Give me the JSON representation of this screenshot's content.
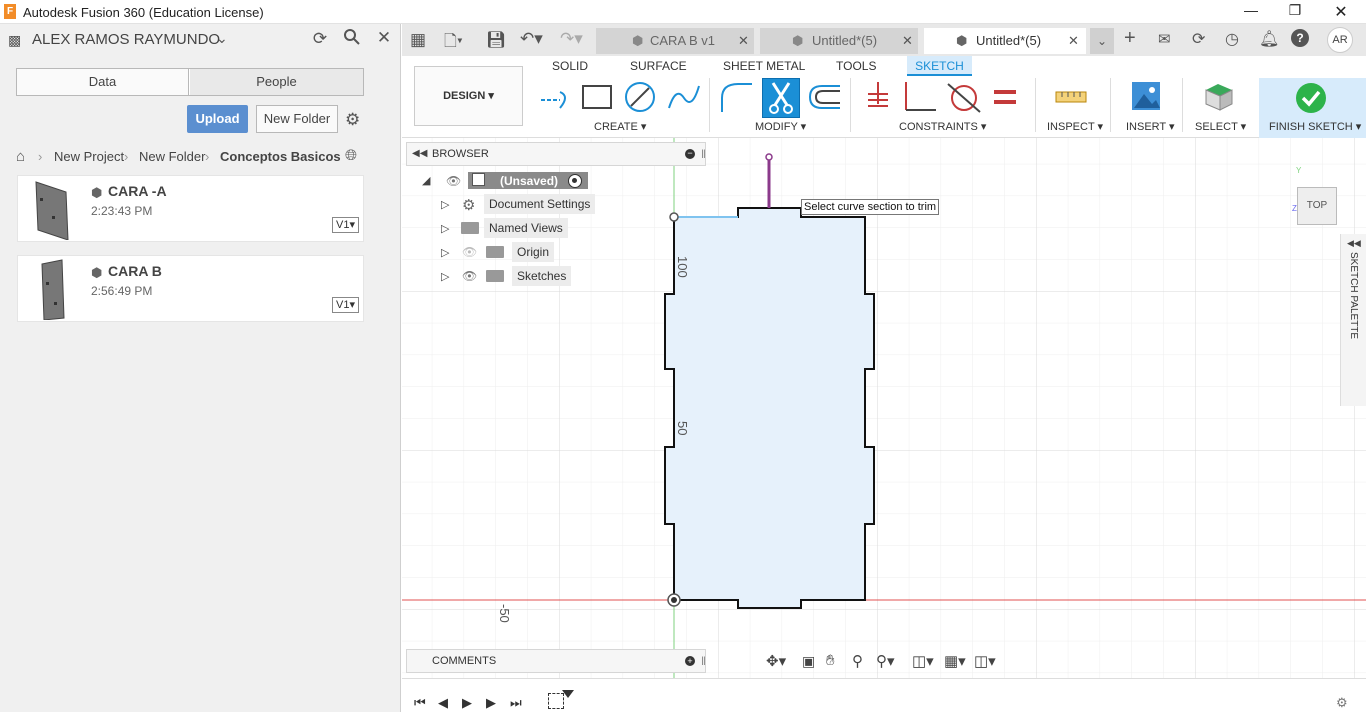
{
  "window": {
    "title": "Autodesk Fusion 360 (Education License)",
    "logo_letter": "F"
  },
  "left_panel": {
    "user_name": "ALEX RAMOS RAYMUNDO",
    "tabs": [
      "Data",
      "People"
    ],
    "upload_label": "Upload",
    "new_folder_label": "New Folder",
    "breadcrumb": [
      "New Project",
      "New Folder",
      "Conceptos Basicos"
    ],
    "files": [
      {
        "name": "CARA -A",
        "time": "2:23:43 PM",
        "version": "V1"
      },
      {
        "name": "CARA B",
        "time": "2:56:49 PM",
        "version": "V1"
      }
    ]
  },
  "doc_tabs": [
    {
      "label": "CARA B v1",
      "active": false
    },
    {
      "label": "Untitled*(5)",
      "active": false
    },
    {
      "label": "Untitled*(5)",
      "active": true
    }
  ],
  "user_initials": "AR",
  "ribbon": {
    "workspace": "DESIGN",
    "tabs": [
      "SOLID",
      "SURFACE",
      "SHEET METAL",
      "TOOLS",
      "SKETCH"
    ],
    "active_tab": "SKETCH",
    "groups": [
      "CREATE",
      "MODIFY",
      "CONSTRAINTS",
      "INSPECT",
      "INSERT",
      "SELECT",
      "FINISH SKETCH"
    ]
  },
  "browser": {
    "title": "BROWSER",
    "root": "(Unsaved)",
    "items": [
      "Document Settings",
      "Named Views",
      "Origin",
      "Sketches"
    ]
  },
  "comments_label": "COMMENTS",
  "tooltip": "Select curve section to trim",
  "viewcube_label": "TOP",
  "sketch_palette_label": "SKETCH PALETTE",
  "axis_labels": {
    "y100": "100",
    "y50": "50",
    "xm50": "-50"
  },
  "colors": {
    "accent": "#1b8fd6",
    "finish": "#2db34a",
    "upload": "#5b8fd0",
    "x_axis": "#e05050",
    "y_axis": "#7fd27f"
  }
}
